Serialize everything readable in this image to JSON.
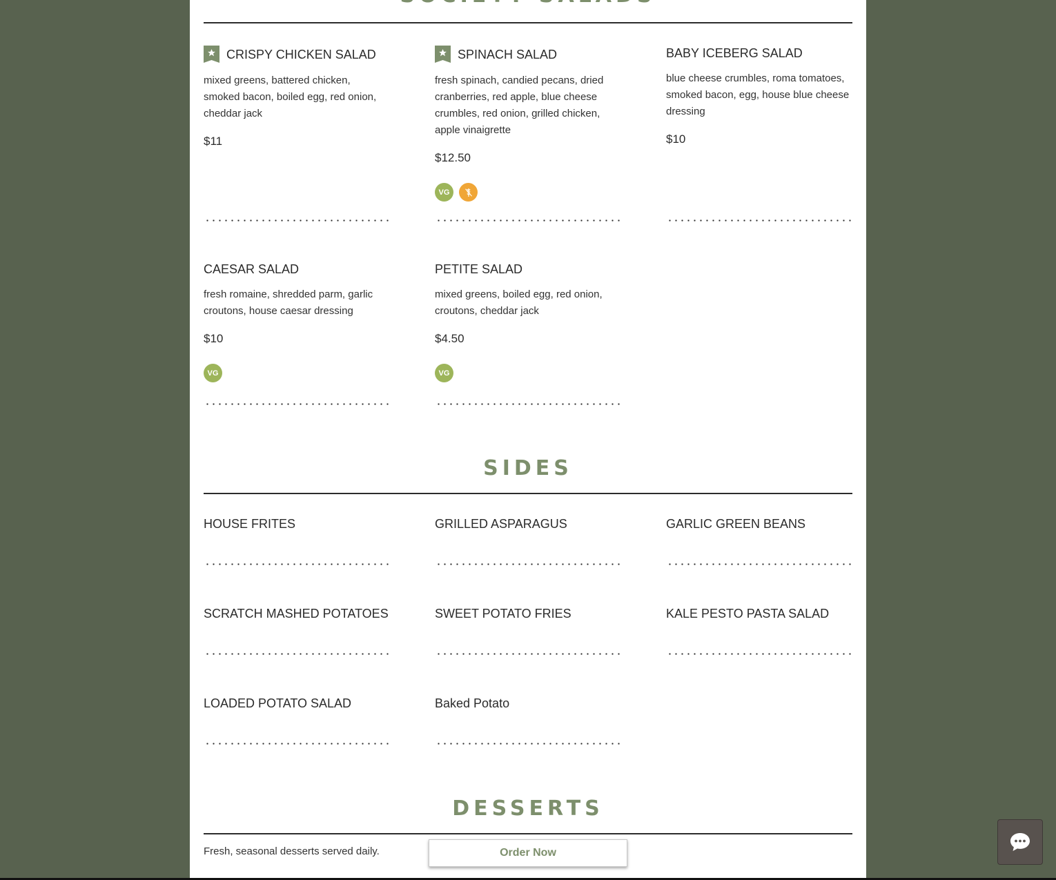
{
  "sections": {
    "salads": {
      "title": "SOCIETY SALADS",
      "items": [
        {
          "name": "CRISPY CHICKEN SALAD",
          "featured": true,
          "description": "mixed greens, battered chicken, smoked bacon, boiled egg, red onion, cheddar jack",
          "price": "$11",
          "badges": []
        },
        {
          "name": "SPINACH SALAD",
          "featured": true,
          "description": "fresh spinach, candied pecans, dried cranberries, red apple, blue cheese crumbles, red onion, grilled chicken, apple vinaigrette",
          "price": "$12.50",
          "badges": [
            "VG",
            "gluten-free-icon"
          ]
        },
        {
          "name": "BABY ICEBERG SALAD",
          "featured": false,
          "description": "blue cheese crumbles, roma tomatoes, smoked bacon, egg, house blue cheese dressing",
          "price": "$10",
          "badges": []
        },
        {
          "name": "CAESAR SALAD",
          "featured": false,
          "description": "fresh romaine, shredded parm, garlic croutons, house caesar dressing",
          "price": "$10",
          "badges": [
            "VG"
          ]
        },
        {
          "name": "PETITE SALAD",
          "featured": false,
          "description": "mixed greens, boiled egg, red onion, croutons, cheddar jack",
          "price": "$4.50",
          "badges": [
            "VG"
          ]
        }
      ]
    },
    "sides": {
      "title": "SIDES",
      "items": [
        {
          "name": "HOUSE FRITES"
        },
        {
          "name": "GRILLED ASPARAGUS"
        },
        {
          "name": "GARLIC GREEN BEANS"
        },
        {
          "name": "SCRATCH MASHED POTATOES"
        },
        {
          "name": "SWEET POTATO FRIES"
        },
        {
          "name": "KALE PESTO PASTA SALAD"
        },
        {
          "name": "LOADED POTATO SALAD"
        },
        {
          "name": "Baked Potato"
        }
      ]
    },
    "desserts": {
      "title": "DESSERTS",
      "description": "Fresh, seasonal desserts served daily."
    }
  },
  "order_button": {
    "label": "Order Now"
  },
  "chat": {
    "icon": "chat-bubble-icon"
  },
  "colors": {
    "background": "#58624f",
    "accent": "#7d8f6c",
    "vg_badge": "#9db55a",
    "gf_badge": "#f0a637"
  }
}
